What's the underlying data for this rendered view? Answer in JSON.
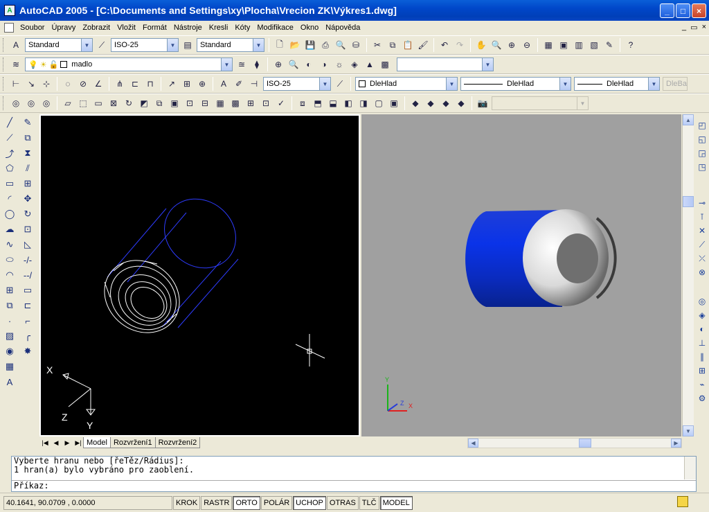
{
  "window": {
    "title": "AutoCAD 2005 - [C:\\Documents and Settings\\xy\\Plocha\\Vrecion ZK\\Výkres1.dwg]",
    "minimize": "_",
    "maximize": "□",
    "close": "×"
  },
  "menu": {
    "items": [
      "Soubor",
      "Úpravy",
      "Zobrazit",
      "Vložit",
      "Formát",
      "Nástroje",
      "Kresli",
      "Kóty",
      "Modifikace",
      "Okno",
      "Nápověda"
    ]
  },
  "toolbar": {
    "text_style": "Standard",
    "dim_style": "ISO-25",
    "table_style": "Standard",
    "layer_name": "madlo",
    "dim_style_2": "ISO-25",
    "color": "DleHlad",
    "linetype": "DleHlad",
    "lineweight": "DleHlad",
    "plotstyle": "DleBar"
  },
  "viewports": {
    "ucs_labels": {
      "x": "X",
      "y": "Y",
      "z": "Z"
    }
  },
  "tabs": [
    "Model",
    "Rozvržení1",
    "Rozvržení2"
  ],
  "command": {
    "line1": "Vyberte hranu nebo [řeTěz/Rádius]:",
    "line2": "1 hran(a) bylo vybráno pro zaoblení.",
    "prompt": "Příkaz:"
  },
  "status": {
    "coordinates": "40.1641, 90.0709 , 0.0000",
    "buttons": [
      "KROK",
      "RASTR",
      "ORTO",
      "POLÁR",
      "UCHOP",
      "OTRAS",
      "TLČ",
      "MODEL"
    ],
    "active": [
      "ORTO",
      "UCHOP",
      "MODEL"
    ]
  },
  "colors": {
    "title_blue": "#0a46c4",
    "cylinder_blue": "#0a33d4",
    "wireframe_blue": "#2e3cff",
    "model_bg": "#000000",
    "render_bg": "#a0a0a0"
  }
}
